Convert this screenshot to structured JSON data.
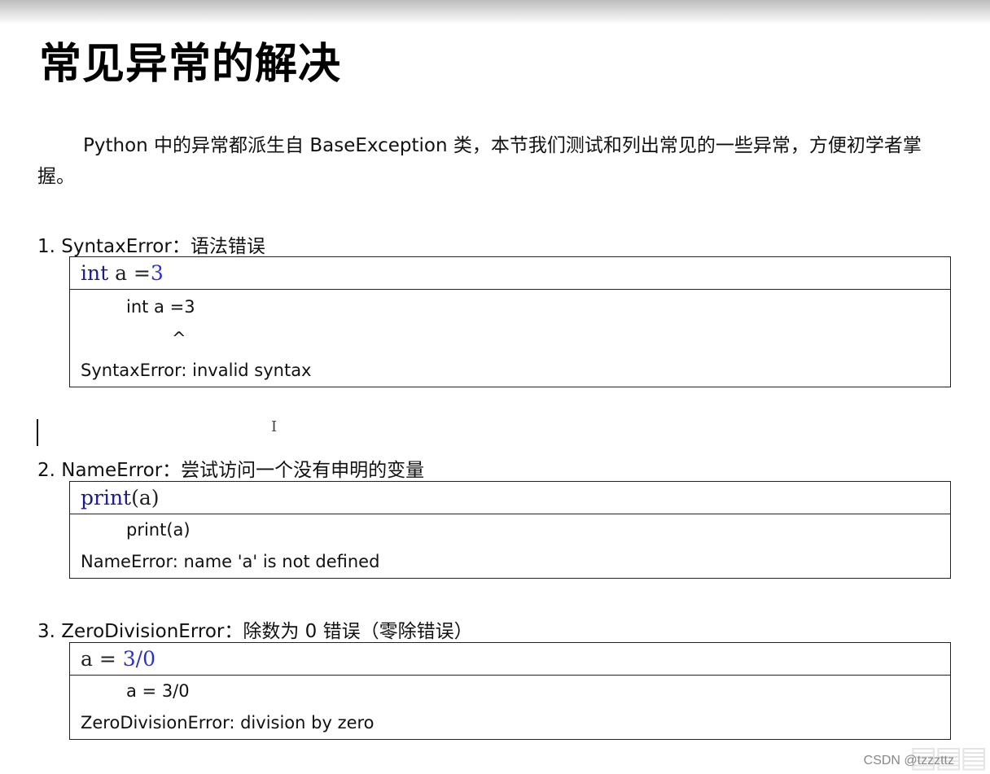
{
  "title": "常见异常的解决",
  "intro": "Python 中的异常都派生自 BaseException 类，本节我们测试和列出常见的一些异常，方便初学者掌握。",
  "sections": [
    {
      "heading": "1.  SyntaxError：语法错误",
      "code": {
        "kw": "int",
        "mid": " a =",
        "num": "3"
      },
      "output": [
        "int a =3",
        "^",
        "SyntaxError: invalid syntax"
      ]
    },
    {
      "heading": "2.  NameError：尝试访问一个没有申明的变量",
      "code": {
        "kw": "print",
        "mid": "(a)",
        "num": ""
      },
      "output": [
        "print(a)",
        "NameError: name 'a' is not defined"
      ]
    },
    {
      "heading": "3.  ZeroDivisionError：除数为 0 错误（零除错误）",
      "code": {
        "kw": "",
        "mid": "a = ",
        "num": "3/0"
      },
      "output": [
        "a = 3/0",
        "ZeroDivisionError: division by zero"
      ]
    }
  ],
  "cursor_icon": "text-cursor",
  "watermark": "CSDN @tzzzttz",
  "colors": {
    "keyword": "#1a1a8a",
    "number": "#3030c8"
  }
}
